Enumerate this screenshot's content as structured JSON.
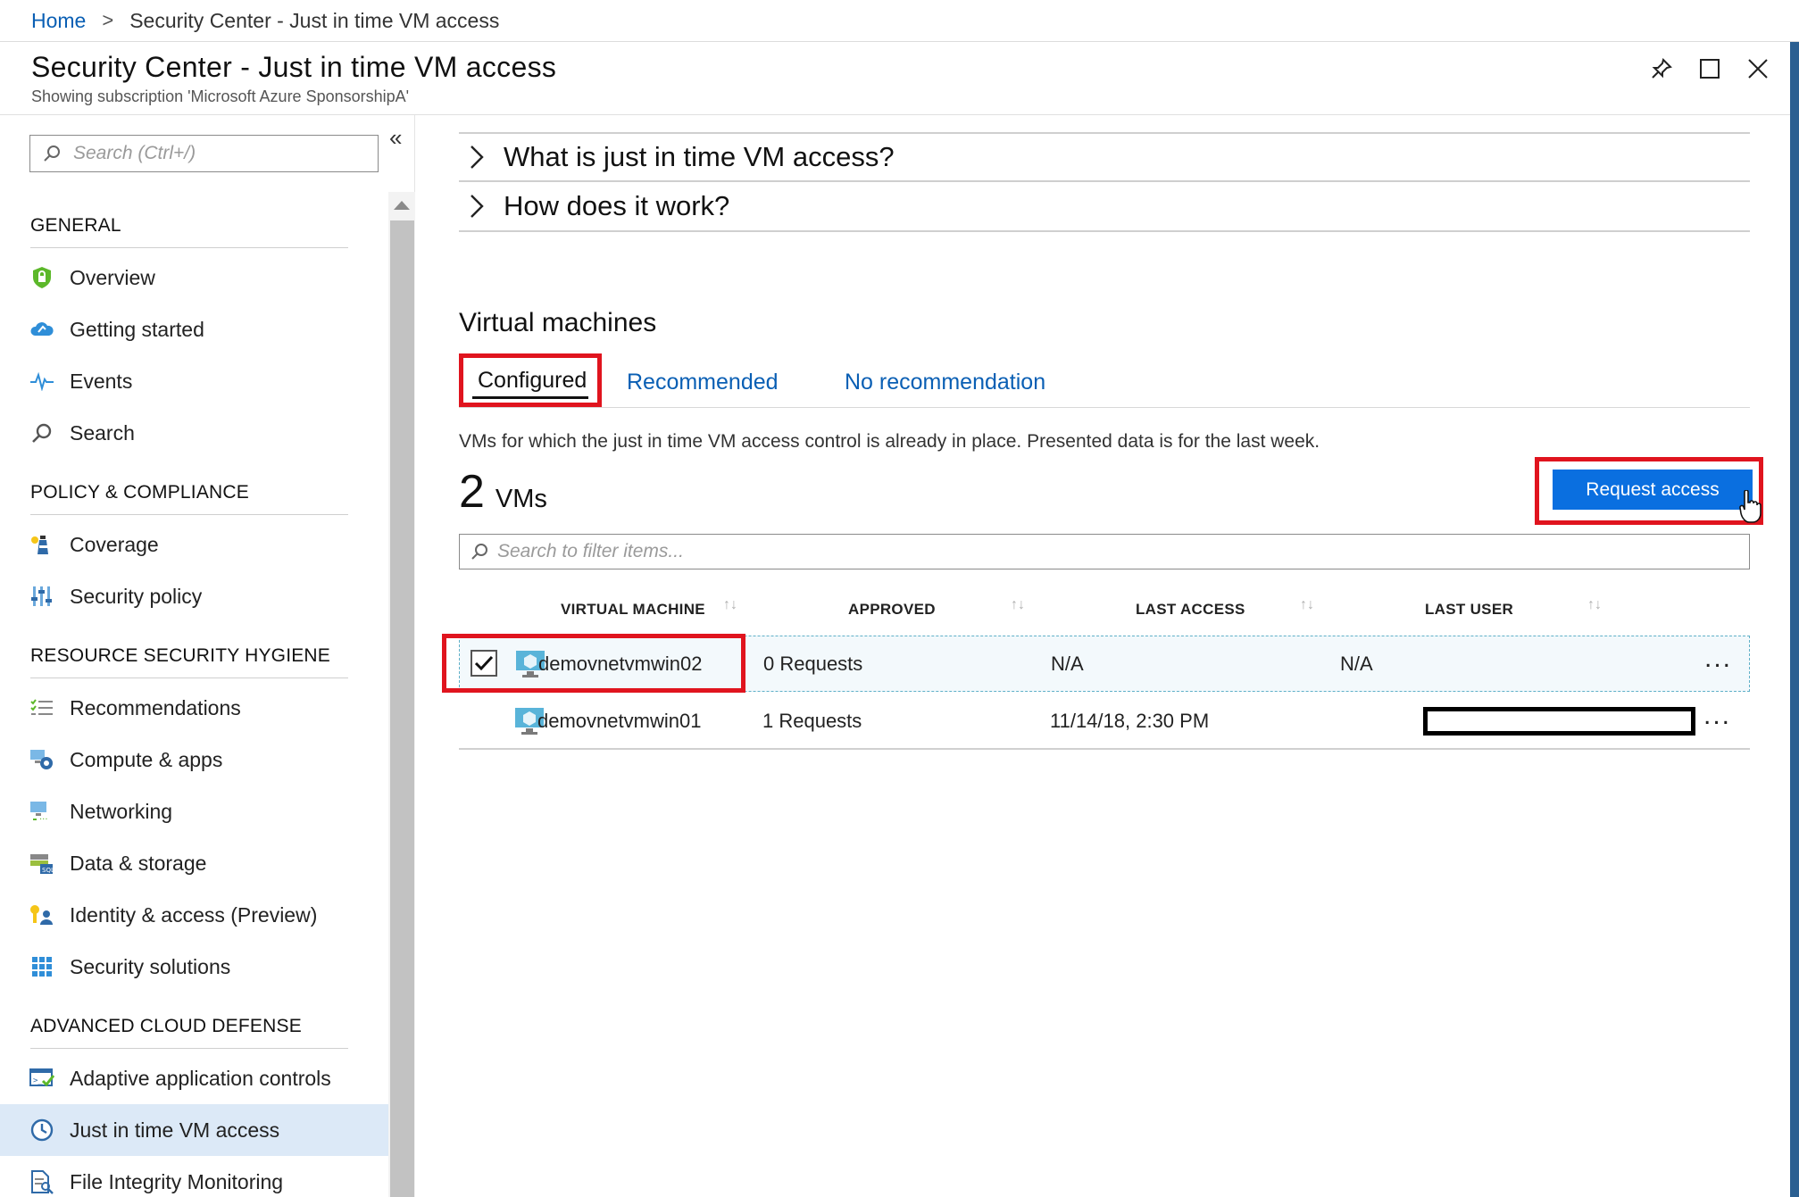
{
  "breadcrumb": {
    "home": "Home",
    "separator": ">",
    "current": "Security Center - Just in time VM access"
  },
  "header": {
    "title": "Security Center - Just in time VM access",
    "subtitle": "Showing subscription 'Microsoft Azure SponsorshipA'"
  },
  "sidebar": {
    "search_placeholder": "Search (Ctrl+/)",
    "collapse_glyph": "«",
    "sections": [
      {
        "title": "GENERAL",
        "items": [
          {
            "label": "Overview",
            "icon": "shield-icon"
          },
          {
            "label": "Getting started",
            "icon": "cloud-icon"
          },
          {
            "label": "Events",
            "icon": "pulse-icon"
          },
          {
            "label": "Search",
            "icon": "search-icon"
          }
        ]
      },
      {
        "title": "POLICY & COMPLIANCE",
        "items": [
          {
            "label": "Coverage",
            "icon": "lighthouse-icon"
          },
          {
            "label": "Security policy",
            "icon": "policy-sliders-icon"
          }
        ]
      },
      {
        "title": "RESOURCE SECURITY HYGIENE",
        "items": [
          {
            "label": "Recommendations",
            "icon": "list-icon"
          },
          {
            "label": "Compute & apps",
            "icon": "compute-icon"
          },
          {
            "label": "Networking",
            "icon": "network-icon"
          },
          {
            "label": "Data & storage",
            "icon": "storage-icon"
          },
          {
            "label": "Identity & access (Preview)",
            "icon": "identity-icon"
          },
          {
            "label": "Security solutions",
            "icon": "grid-icon"
          }
        ]
      },
      {
        "title": "ADVANCED CLOUD DEFENSE",
        "items": [
          {
            "label": "Adaptive application controls",
            "icon": "app-control-icon"
          },
          {
            "label": "Just in time VM access",
            "icon": "clock-icon",
            "active": true
          },
          {
            "label": "File Integrity Monitoring",
            "icon": "file-search-icon"
          }
        ]
      }
    ]
  },
  "main": {
    "accordion": [
      {
        "label": "What is just in time VM access?"
      },
      {
        "label": "How does it work?"
      }
    ],
    "section_title": "Virtual machines",
    "tabs": [
      {
        "label": "Configured",
        "selected": true
      },
      {
        "label": "Recommended"
      },
      {
        "label": "No recommendation"
      }
    ],
    "description": "VMs for which the just in time VM access control is already in place. Presented data is for the last week.",
    "count": {
      "number": "2",
      "unit": "VMs"
    },
    "request_button": "Request access",
    "filter_placeholder": "Search to filter items...",
    "table": {
      "columns": [
        "VIRTUAL MACHINE",
        "APPROVED",
        "LAST ACCESS",
        "LAST USER"
      ],
      "sort_glyph": "↑↓",
      "rows": [
        {
          "name": "demovnetvmwin02",
          "approved": "0 Requests",
          "last_access": "N/A",
          "last_user": "N/A",
          "checked": true
        },
        {
          "name": "demovnetvmwin01",
          "approved": "1 Requests",
          "last_access": "11/14/18, 2:30 PM",
          "last_user": "",
          "checked": false
        }
      ],
      "more_glyph": "..."
    }
  },
  "colors": {
    "accent": "#0a6fe0",
    "link": "#0a5fb4",
    "highlight": "#e0141e",
    "active_nav": "#dce9f7"
  }
}
